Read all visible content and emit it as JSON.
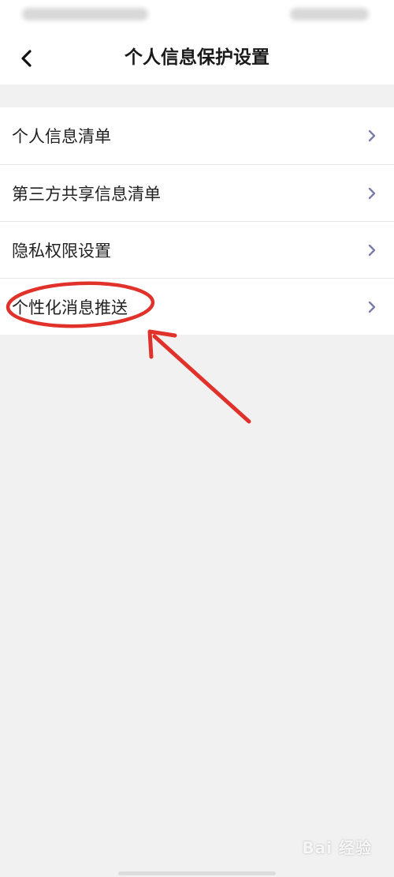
{
  "header": {
    "title": "个人信息保护设置",
    "back_icon": "chevron-left-icon"
  },
  "menu": {
    "items": [
      {
        "label": "个人信息清单",
        "icon": "chevron-right-icon"
      },
      {
        "label": "第三方共享信息清单",
        "icon": "chevron-right-icon"
      },
      {
        "label": "隐私权限设置",
        "icon": "chevron-right-icon"
      },
      {
        "label": "个性化消息推送",
        "icon": "chevron-right-icon"
      }
    ]
  },
  "annotation": {
    "color": "#e0312a",
    "target": "个性化消息推送"
  },
  "watermark": {
    "text": "Bai 经验"
  },
  "colors": {
    "background": "#f1f1f1",
    "surface": "#ffffff",
    "chevron": "#7b7fa8"
  }
}
